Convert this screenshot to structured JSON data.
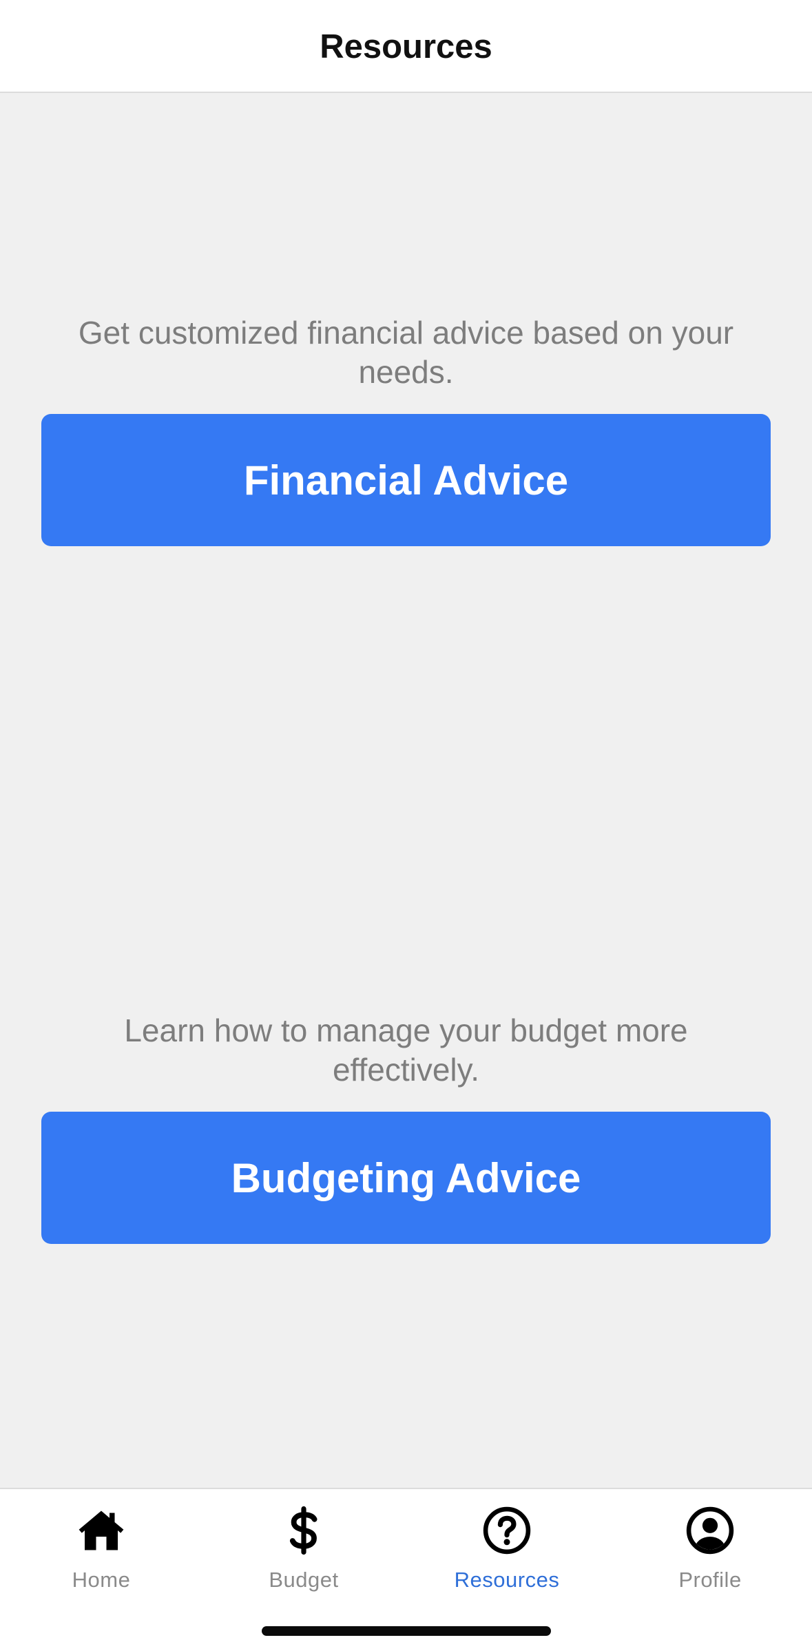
{
  "header": {
    "title": "Resources"
  },
  "sections": [
    {
      "description": "Get customized financial advice based on your needs.",
      "button_label": "Financial Advice"
    },
    {
      "description": "Learn how to manage your budget more effectively.",
      "button_label": "Budgeting Advice"
    }
  ],
  "tabbar": {
    "active_tab": "Resources",
    "active_color": "#2f6fd8",
    "inactive_color": "#8a8a8a",
    "tabs": [
      {
        "label": "Home",
        "icon": "home-icon"
      },
      {
        "label": "Budget",
        "icon": "dollar-icon"
      },
      {
        "label": "Resources",
        "icon": "help-circle-icon"
      },
      {
        "label": "Profile",
        "icon": "user-circle-icon"
      }
    ]
  },
  "colors": {
    "primary_button": "#3579f3",
    "background": "#f0f0f0"
  }
}
